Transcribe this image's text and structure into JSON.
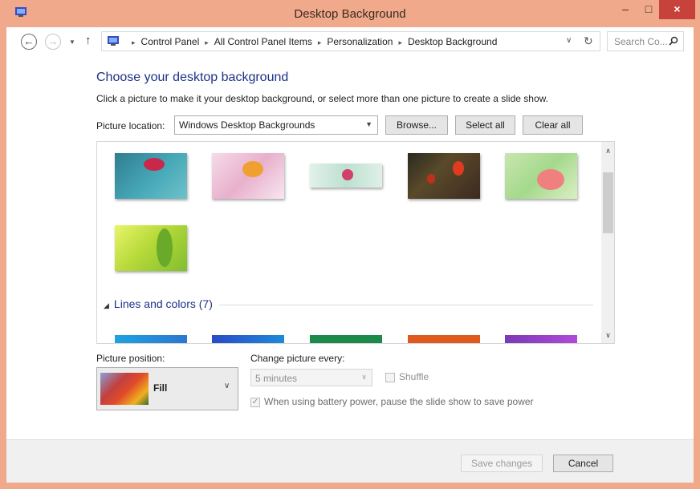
{
  "window": {
    "title": "Desktop Background",
    "minimize_label": "–",
    "maximize_label": "□",
    "close_label": "×"
  },
  "nav": {
    "breadcrumbs": [
      "Control Panel",
      "All Control Panel Items",
      "Personalization",
      "Desktop Background"
    ],
    "breadcrumb_sep": "▸",
    "search_placeholder": "Search Co..."
  },
  "page": {
    "heading": "Choose your desktop background",
    "instruction": "Click a picture to make it your desktop background, or select more than one picture to create a slide show."
  },
  "location": {
    "label": "Picture location:",
    "value": "Windows Desktop Backgrounds",
    "browse_label": "Browse...",
    "select_all_label": "Select all",
    "clear_all_label": "Clear all"
  },
  "gallery": {
    "group_label": "Lines and colors (7)"
  },
  "position": {
    "label": "Picture position:",
    "value": "Fill"
  },
  "slideshow": {
    "label": "Change picture every:",
    "interval": "5 minutes",
    "shuffle_label": "Shuffle",
    "battery_label": "When using battery power, pause the slide show to save power",
    "battery_checked": true,
    "battery_mark": "✓"
  },
  "footer": {
    "save_label": "Save changes",
    "cancel_label": "Cancel"
  }
}
